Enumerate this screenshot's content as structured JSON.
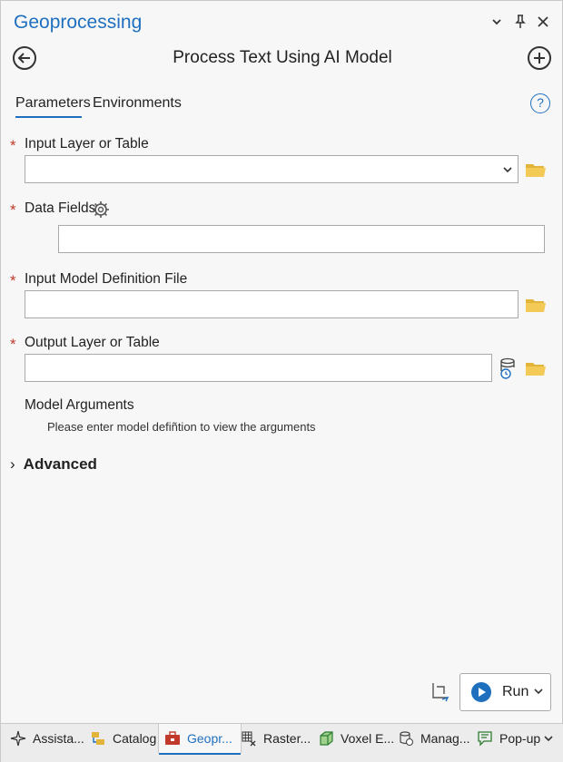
{
  "app": {
    "title": "Geoprocessing"
  },
  "tool": {
    "title": "Process Text Using AI Model"
  },
  "tabs": {
    "parameters": "Parameters",
    "environments": "Environments"
  },
  "help_icon": "?",
  "params": {
    "input_layer": {
      "label": "Input Layer or Table",
      "value": "",
      "required": "*"
    },
    "data_fields": {
      "label": "Data Fields",
      "value": "",
      "required": "*"
    },
    "model_def": {
      "label": "Input Model Definition File",
      "value": "",
      "required": "*"
    },
    "output_layer": {
      "label": "Output Layer or Table",
      "value": "",
      "required": "*"
    }
  },
  "model_args": {
    "title": "Model Arguments",
    "note": "Please enter model defiñtion to view the arguments"
  },
  "advanced": {
    "label": "Advanced",
    "chevron": "›"
  },
  "run": {
    "label": "Run"
  },
  "bottom_tabs": [
    {
      "label": "Assista...",
      "icon": "sparkle-icon"
    },
    {
      "label": "Catalog",
      "icon": "catalog-icon"
    },
    {
      "label": "Geopr...",
      "icon": "toolbox-icon",
      "active": true
    },
    {
      "label": "Raster...",
      "icon": "raster-icon"
    },
    {
      "label": "Voxel E...",
      "icon": "voxel-icon"
    },
    {
      "label": "Manag...",
      "icon": "database-icon"
    },
    {
      "label": "Pop-up",
      "icon": "popup-icon"
    }
  ],
  "colors": {
    "accent": "#1f6fbf",
    "required": "#c0392b",
    "folder": "#e2b53a"
  }
}
